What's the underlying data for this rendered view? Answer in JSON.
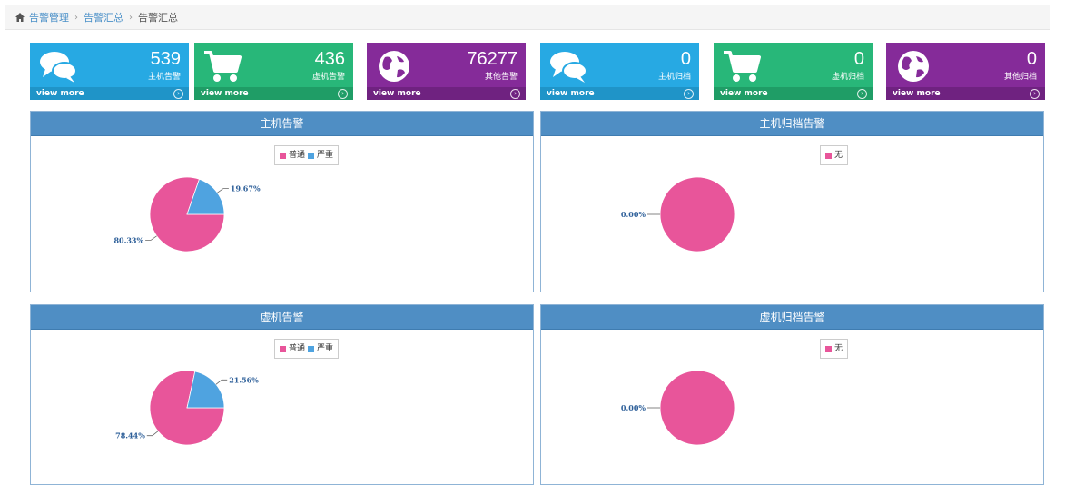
{
  "breadcrumb": {
    "items": [
      "告警管理",
      "告警汇总"
    ],
    "current": "告警汇总"
  },
  "tiles": [
    {
      "value": "539",
      "label": "主机告警",
      "link": "view more",
      "icon": "comments-icon"
    },
    {
      "value": "436",
      "label": "虚机告警",
      "link": "view more",
      "icon": "shopping-cart-icon"
    },
    {
      "value": "76277",
      "label": "其他告警",
      "link": "view more",
      "icon": "globe-icon"
    },
    {
      "value": "0",
      "label": "主机归档",
      "link": "view more",
      "icon": "comments-icon"
    },
    {
      "value": "0",
      "label": "虚机归档",
      "link": "view more",
      "icon": "shopping-cart-icon"
    },
    {
      "value": "0",
      "label": "其他归档",
      "link": "view more",
      "icon": "globe-icon"
    }
  ],
  "colors": {
    "normal": "#e8559a",
    "severe": "#4fa3e0",
    "none": "#e8559a",
    "header": "#4f8ec4"
  },
  "panels": [
    {
      "title": "主机告警",
      "legend": [
        "普通",
        "严重"
      ]
    },
    {
      "title": "主机归档告警",
      "legend": [
        "无"
      ]
    },
    {
      "title": "虚机告警",
      "legend": [
        "普通",
        "严重"
      ]
    },
    {
      "title": "虚机归档告警",
      "legend": [
        "无"
      ]
    }
  ],
  "chart_data": [
    {
      "type": "pie",
      "title": "主机告警",
      "legend": [
        "普通",
        "严重"
      ],
      "slices": [
        {
          "name": "普通",
          "value": 80.33,
          "label": "80.33%"
        },
        {
          "name": "严重",
          "value": 19.67,
          "label": "19.67%"
        }
      ]
    },
    {
      "type": "pie",
      "title": "主机归档告警",
      "legend": [
        "无"
      ],
      "slices": [
        {
          "name": "无",
          "value": 100,
          "label": "0.00%"
        }
      ]
    },
    {
      "type": "pie",
      "title": "虚机告警",
      "legend": [
        "普通",
        "严重"
      ],
      "slices": [
        {
          "name": "普通",
          "value": 78.44,
          "label": "78.44%"
        },
        {
          "name": "严重",
          "value": 21.56,
          "label": "21.56%"
        }
      ]
    },
    {
      "type": "pie",
      "title": "虚机归档告警",
      "legend": [
        "无"
      ],
      "slices": [
        {
          "name": "无",
          "value": 100,
          "label": "0.00%"
        }
      ]
    }
  ]
}
